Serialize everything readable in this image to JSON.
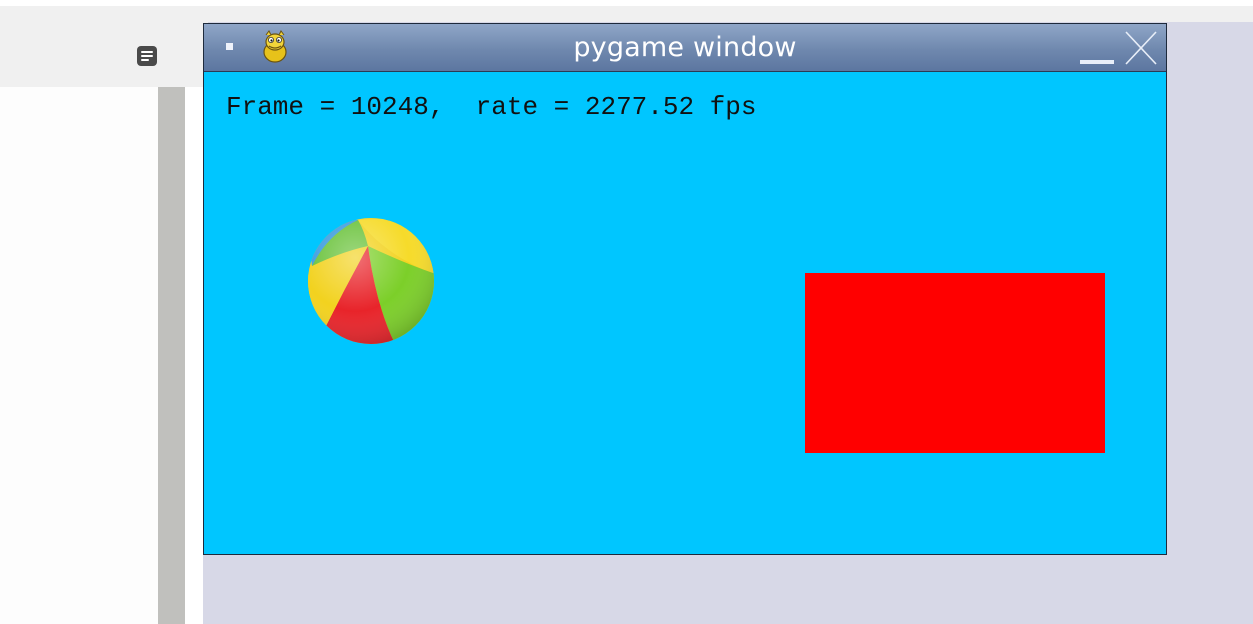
{
  "window": {
    "title": "pygame window",
    "titlebar_icon": "pygame-snake-icon",
    "controls": [
      "system-menu-icon",
      "minimize-icon",
      "close-icon"
    ]
  },
  "game": {
    "status_text": "Frame = 10248,  rate = 2277.52 fps",
    "background_color": "#00c6ff",
    "objects": [
      {
        "kind": "beach-ball",
        "colors": [
          "#f2d21f",
          "#7ccf29",
          "#e8242a",
          "#3a9be0"
        ]
      },
      {
        "kind": "rectangle",
        "color": "#ff0000"
      }
    ]
  },
  "desktop": {
    "menu_icon": "hamburger-menu-icon"
  }
}
